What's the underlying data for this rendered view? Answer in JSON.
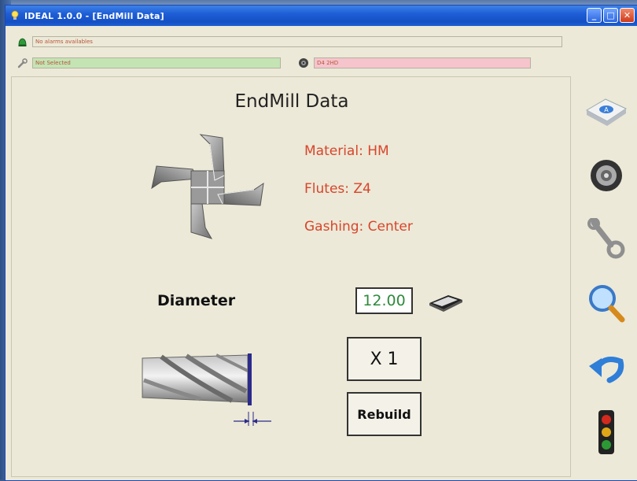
{
  "window": {
    "title": "IDEAL 1.0.0 - [EndMill Data]",
    "controls": {
      "minimize": "_",
      "maximize": "□",
      "close": "✕"
    }
  },
  "status": {
    "alarms_text": "No alarms availables",
    "selection_text": "Not Selected",
    "wheel_text": "D4 2HD"
  },
  "panel": {
    "title": "EndMill Data",
    "properties": {
      "material": "Material: HM",
      "flutes": "Flutes: Z4",
      "gashing": "Gashing: Center"
    },
    "diameter_label": "Diameter",
    "diameter_value": "12.00",
    "multiplier_label": "X 1",
    "rebuild_label": "Rebuild"
  },
  "sidebar": {
    "buttons": [
      "keyboard-icon",
      "grinding-wheel-icon",
      "wrench-icon",
      "magnifier-icon",
      "undo-icon",
      "traffic-light-icon"
    ]
  },
  "colors": {
    "accent_text": "#d8452b",
    "value_text": "#2e8a3c",
    "panel_bg": "#ece9d8",
    "titlebar": "#1e5ed6",
    "field_green": "#c4e4b4",
    "field_pink": "#f6c4cc"
  }
}
